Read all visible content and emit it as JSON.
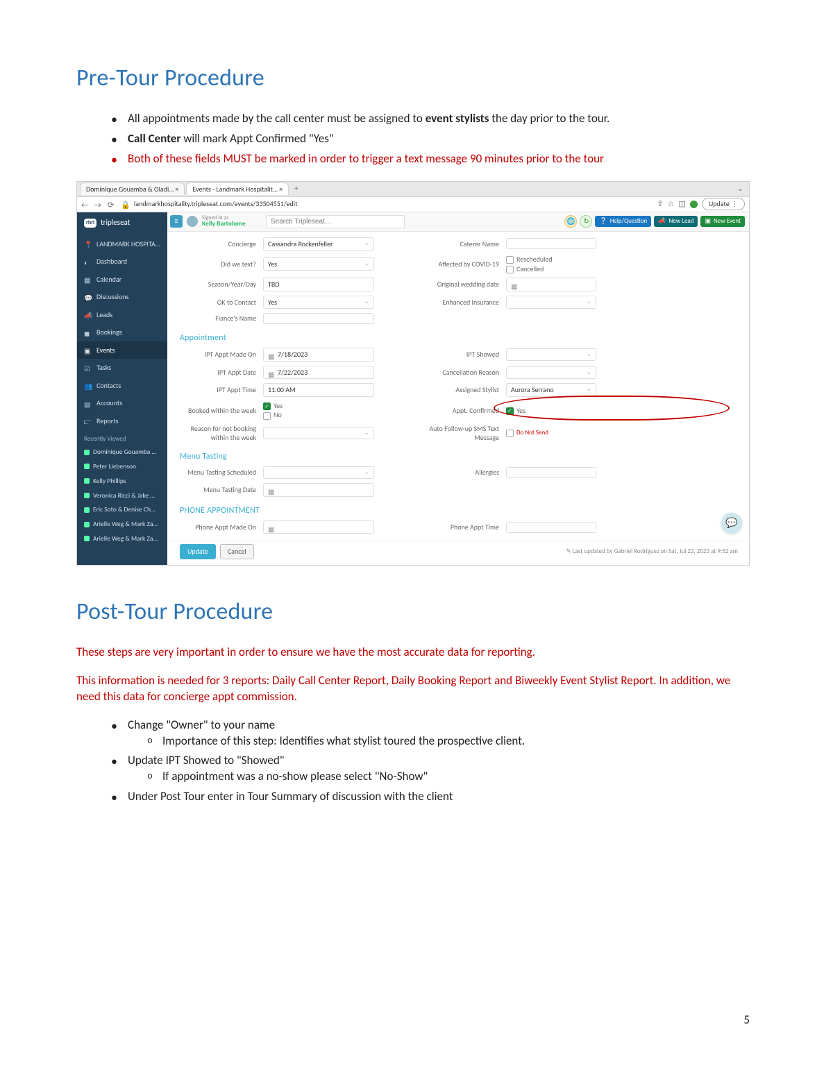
{
  "page_number": "5",
  "headings": {
    "pre": "Pre-Tour Procedure",
    "post": "Post-Tour Procedure"
  },
  "pre_bullets": {
    "b1a": "All appointments made by the call center must be assigned to ",
    "b1b": "event stylists",
    "b1c": " the day prior to the tour.",
    "b2a": "Call Center",
    "b2b": " will mark Appt Confirmed \"Yes\"",
    "b3": "Both of these fields MUST be marked in order to trigger a text message 90 minutes prior to the tour"
  },
  "post_paras": {
    "p1": "These steps are very important in order to ensure we have the most accurate data for reporting.",
    "p2": "This information is needed for 3 reports: Daily Call Center Report, Daily Booking Report and Biweekly Event Stylist Report. In addition, we need this data for concierge appt commission."
  },
  "post_bullets": {
    "b1": "Change \"Owner\" to your name",
    "b1s1": "Importance of this step: Identifies what stylist toured the prospective client.",
    "b2": "Update IPT Showed to \"Showed\"",
    "b2s1": "If appointment was a no-show please select \"No-Show\"",
    "b3": "Under Post Tour enter in Tour Summary of discussion with the client"
  },
  "mock": {
    "tab1": "Dominique Gouamba & Oladi…  ×",
    "tab2": "Events - Landmark Hospitalit…  ×",
    "url": "landmarkhospitality.tripleseat.com/events/33504551/edit",
    "update_btn": "Update  ⋮",
    "brand": "tripleseat",
    "signed_as": "Signed in as",
    "signed_name": "Kelly Bartolome",
    "search_placeholder": "Search Tripleseat…",
    "help": "Help/Question",
    "new_lead": "New Lead",
    "new_event": "New Event",
    "nav": {
      "landmark": "LANDMARK HOSPITA…",
      "dashboard": "Dashboard",
      "calendar": "Calendar",
      "discussions": "Discussions",
      "leads": "Leads",
      "bookings": "Bookings",
      "events": "Events",
      "tasks": "Tasks",
      "contacts": "Contacts",
      "accounts": "Accounts",
      "reports": "Reports"
    },
    "recently_viewed": "Recently Viewed",
    "recent": [
      "Dominique Gouamba …",
      "Peter Liebenson",
      "Kelly Phillips",
      "Veronica Ricci & Jake …",
      "Eric Soto & Denise Ch…",
      "Arielle Weg & Mark Za…",
      "Arielle Weg & Mark Za…"
    ],
    "labels": {
      "concierge": "Concierge",
      "did_we_text": "Did we text?",
      "season": "Season/Year/Day",
      "ok_contact": "OK to Contact",
      "fiance": "Fiance's Name",
      "caterer": "Caterer Name",
      "covid": "Affected by COVID-19",
      "orig_wedding": "Original wedding date",
      "enh_ins": "Enhanced Insurance",
      "resched": "Rescheduled",
      "cancelled": "Cancelled",
      "appointment": "Appointment",
      "ipt_made": "IPT Appt Made On",
      "ipt_date": "IPT Appt Date",
      "ipt_time": "IPT Appt Time",
      "booked_week": "Booked within the week",
      "yes": "Yes",
      "no": "No",
      "reason_no_book": "Reason for not booking within the week",
      "ipt_showed": "IPT Showed",
      "cancel_reason": "Cancellation Reason",
      "assigned_stylist": "Assigned Stylist",
      "appt_confirmed": "Appt. Confirmed",
      "auto_sms": "Auto Follow-up SMS Text Message",
      "do_not_send": "Do Not Send",
      "menu_tasting": "Menu Tasting",
      "mt_sched": "Menu Tasting Scheduled",
      "mt_date": "Menu Tasting Date",
      "allergies": "Allergies",
      "phone_appt": "PHONE APPOINTMENT",
      "pa_made": "Phone Appt Made On",
      "pa_time": "Phone Appt Time"
    },
    "values": {
      "concierge": "Cassandra Rockenfeller",
      "did_we_text": "Yes",
      "season": "TBD",
      "ok_contact": "Yes",
      "ipt_made": "7/18/2023",
      "ipt_date": "7/22/2023",
      "ipt_time": "11:00 AM",
      "assigned_stylist": "Aurora Serrano"
    },
    "footer": {
      "update": "Update",
      "cancel": "Cancel",
      "last_updated": "Last updated by Gabriel Rodriguez on Sat, Jul 22, 2023 at 9:52 am"
    }
  }
}
